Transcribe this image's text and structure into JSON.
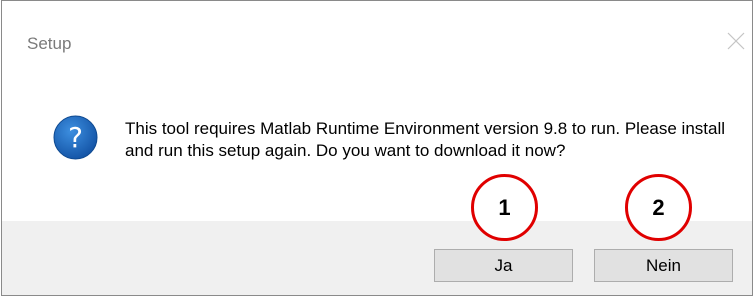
{
  "window": {
    "title": "Setup",
    "close_icon": "close-icon"
  },
  "dialog": {
    "icon": "question-icon",
    "icon_color": "#1c6fc4",
    "message": "This tool requires Matlab Runtime Environment version 9.8 to run. Please install and run this setup again. Do you want to download it now?"
  },
  "buttons": {
    "yes_label": "Ja",
    "no_label": "Nein"
  },
  "annotations": [
    {
      "label": "1"
    },
    {
      "label": "2"
    }
  ],
  "colors": {
    "marker_border": "#e00000",
    "footer_bg": "#f0f0f0",
    "button_bg": "#e1e1e1"
  }
}
